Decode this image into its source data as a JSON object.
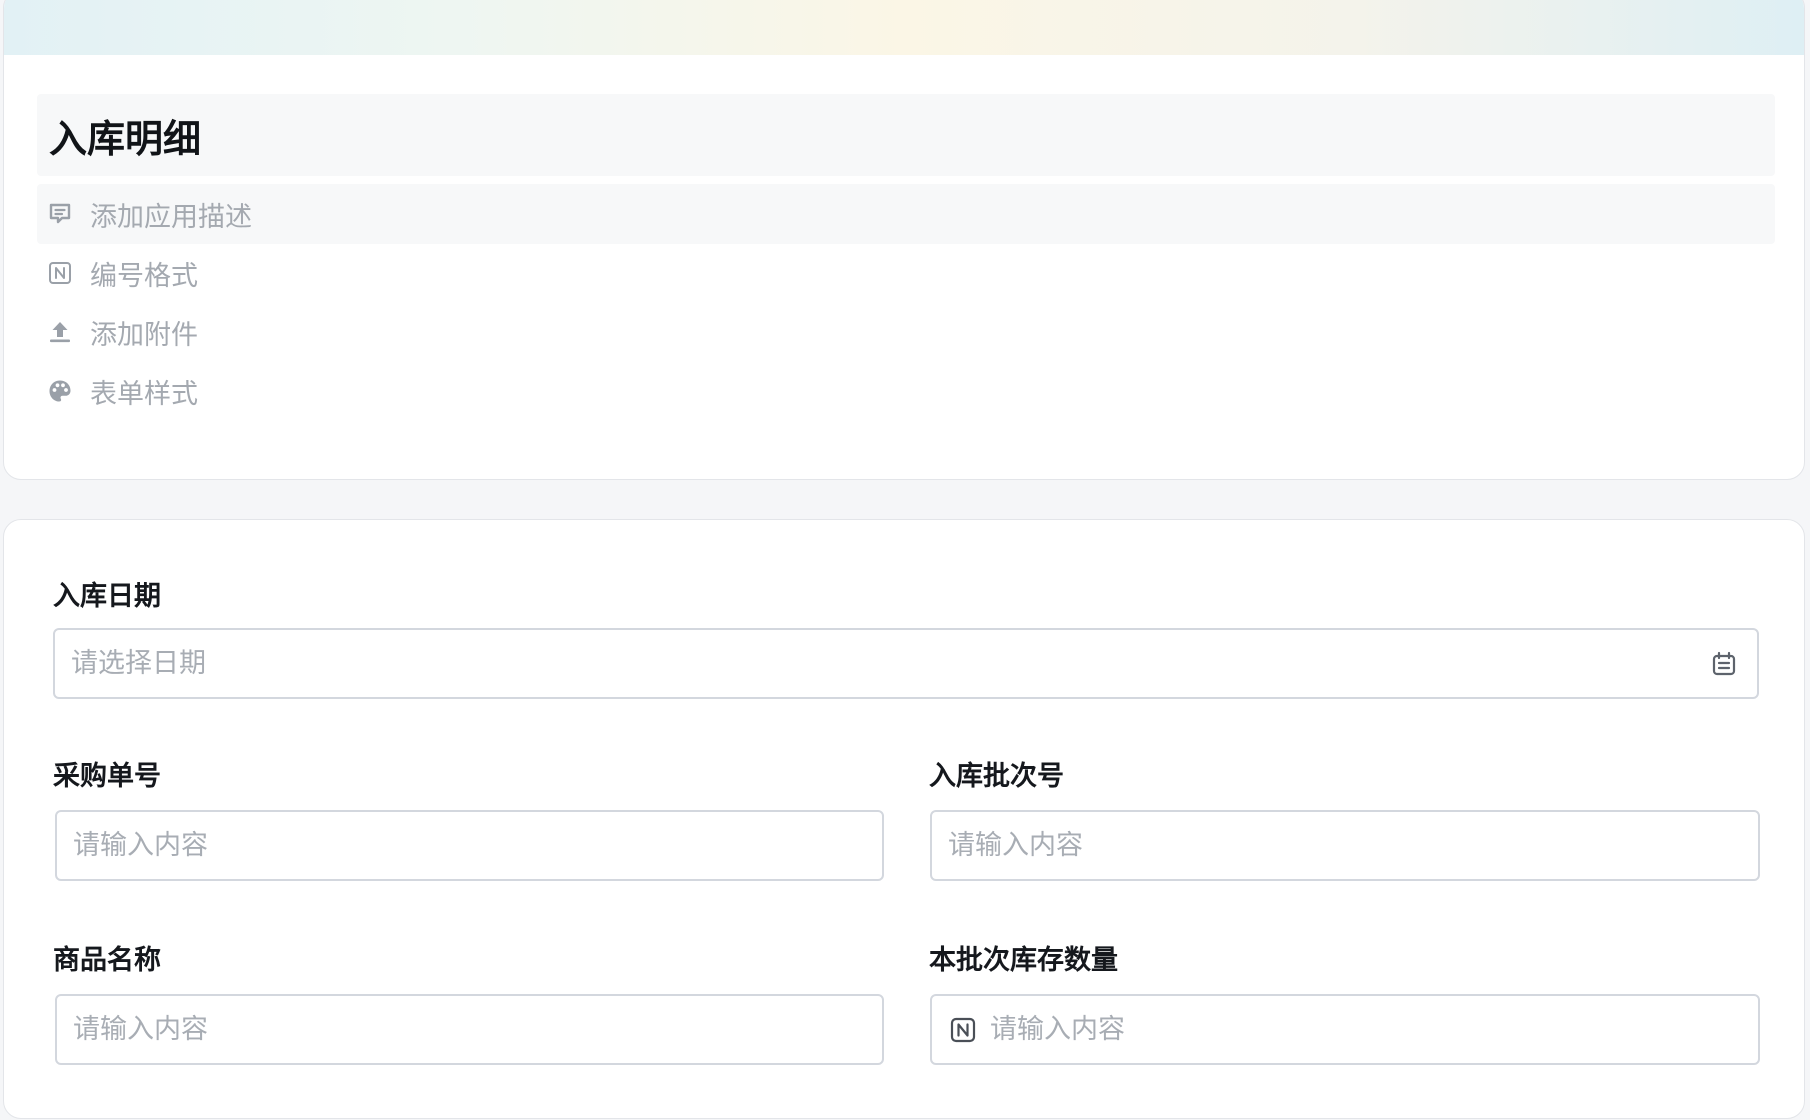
{
  "header": {
    "title": "入库明细",
    "meta_items": [
      {
        "label": "添加应用描述",
        "icon": "comment-icon"
      },
      {
        "label": "编号格式",
        "icon": "number-format-icon"
      },
      {
        "label": "添加附件",
        "icon": "upload-icon"
      },
      {
        "label": "表单样式",
        "icon": "palette-icon"
      }
    ]
  },
  "form": {
    "inbound_date": {
      "label": "入库日期",
      "placeholder": "请选择日期"
    },
    "purchase_order": {
      "label": "采购单号",
      "placeholder": "请输入内容"
    },
    "batch_number": {
      "label": "入库批次号",
      "placeholder": "请输入内容"
    },
    "product_name": {
      "label": "商品名称",
      "placeholder": "请输入内容"
    },
    "batch_stock_qty": {
      "label": "本批次库存数量",
      "placeholder": "请输入内容"
    }
  },
  "colors": {
    "border": "#d3d7de",
    "placeholder": "#a8adb4",
    "muted_text": "#a4a9b0",
    "title_text": "#111418"
  }
}
